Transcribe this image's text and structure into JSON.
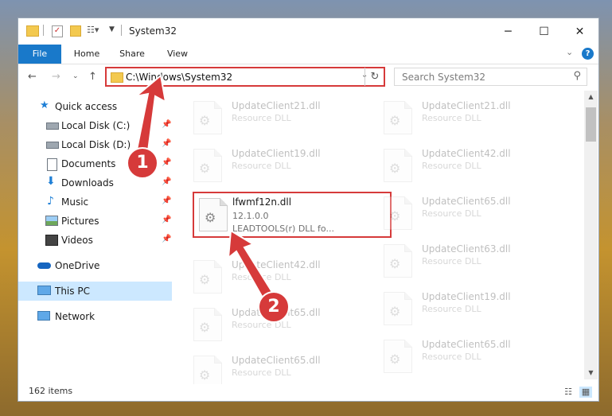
{
  "window": {
    "title": "System32",
    "controls": {
      "minimize": "─",
      "maximize": "☐",
      "close": "✕"
    }
  },
  "ribbon": {
    "tabs": [
      "File",
      "Home",
      "Share",
      "View"
    ],
    "expand_icon": "chevron-down-icon",
    "help_icon": "help-icon"
  },
  "address_bar": {
    "path": "C:\\Windows\\System32",
    "search_placeholder": "Search System32"
  },
  "nav_pane": {
    "items": [
      {
        "label": "Quick access",
        "icon": "star-icon",
        "pinned": false
      },
      {
        "label": "Local Disk (C:)",
        "icon": "drive-icon",
        "pinned": true
      },
      {
        "label": "Local Disk (D:)",
        "icon": "drive-icon",
        "pinned": true
      },
      {
        "label": "Documents",
        "icon": "documents-icon",
        "pinned": true
      },
      {
        "label": "Downloads",
        "icon": "downloads-icon",
        "pinned": true
      },
      {
        "label": "Music",
        "icon": "music-icon",
        "pinned": true
      },
      {
        "label": "Pictures",
        "icon": "pictures-icon",
        "pinned": true
      },
      {
        "label": "Videos",
        "icon": "videos-icon",
        "pinned": true
      },
      {
        "label": "OneDrive",
        "icon": "onedrive-icon",
        "pinned": false
      },
      {
        "label": "This PC",
        "icon": "pc-icon",
        "pinned": false,
        "selected": true
      },
      {
        "label": "Network",
        "icon": "network-icon",
        "pinned": false
      }
    ]
  },
  "files": {
    "left": [
      {
        "name": "UpdateClient21.dll",
        "sub1": "Resource DLL"
      },
      {
        "name": "UpdateClient19.dll",
        "sub1": "Resource DLL"
      },
      {
        "name": "lfwmf12n.dll",
        "sub1": "12.1.0.0",
        "sub2": "LEADTOOLS(r) DLL fo...",
        "highlighted": true
      },
      {
        "name": "UpdateClient42.dll",
        "sub1": "Resource DLL"
      },
      {
        "name": "UpdateClient65.dll",
        "sub1": "Resource DLL"
      },
      {
        "name": "UpdateClient65.dll",
        "sub1": "Resource DLL"
      }
    ],
    "right": [
      {
        "name": "UpdateClient21.dll",
        "sub1": "Resource DLL"
      },
      {
        "name": "UpdateClient42.dll",
        "sub1": "Resource DLL"
      },
      {
        "name": "UpdateClient65.dll",
        "sub1": "Resource DLL"
      },
      {
        "name": "UpdateClient63.dll",
        "sub1": "Resource DLL"
      },
      {
        "name": "UpdateClient19.dll",
        "sub1": "Resource DLL"
      },
      {
        "name": "UpdateClient65.dll",
        "sub1": "Resource DLL"
      }
    ]
  },
  "status": {
    "item_count": "162 items"
  },
  "annotations": {
    "step1": "1",
    "step2": "2"
  },
  "colors": {
    "accent": "#1979ca",
    "highlight": "#d63a3a",
    "selected": "#cce8ff"
  }
}
